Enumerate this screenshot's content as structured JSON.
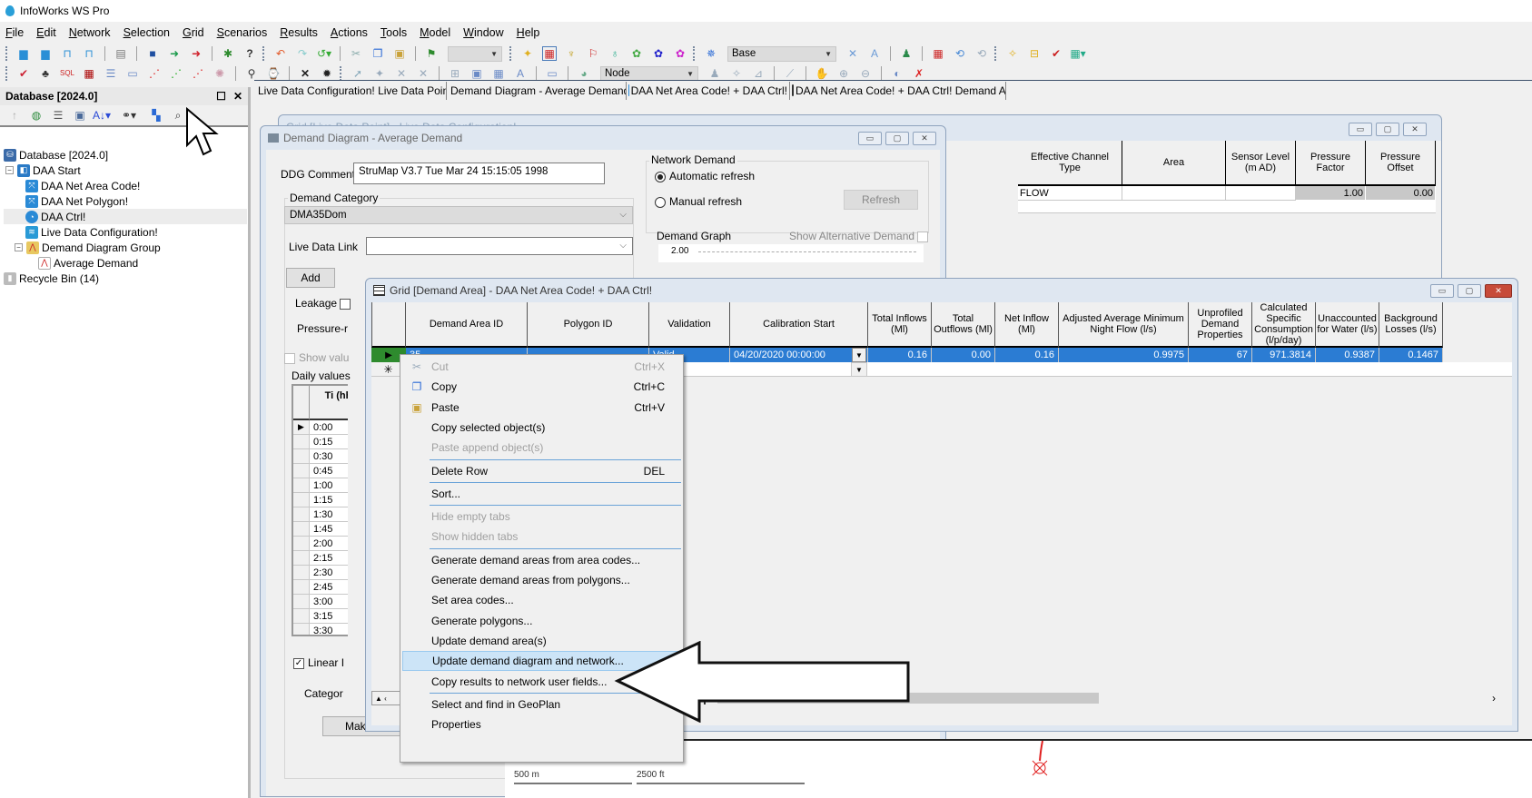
{
  "app": {
    "title": "InfoWorks WS Pro"
  },
  "menu": [
    "File",
    "Edit",
    "Network",
    "Selection",
    "Grid",
    "Scenarios",
    "Results",
    "Actions",
    "Tools",
    "Model",
    "Window",
    "Help"
  ],
  "toolbar": {
    "scenario_combo": "Base",
    "object_combo": "Node",
    "blank_combo": ""
  },
  "database_panel": {
    "title": "Database [2024.0]",
    "tree": [
      {
        "label": "Database [2024.0]",
        "icon": "database-icon",
        "level": 0
      },
      {
        "label": "DAA Start",
        "icon": "model-group-icon",
        "level": 1,
        "expanded": true
      },
      {
        "label": "DAA Net Area Code!",
        "icon": "network-icon",
        "level": 2
      },
      {
        "label": "DAA Net Polygon!",
        "icon": "network-icon",
        "level": 2
      },
      {
        "label": "DAA Ctrl!",
        "icon": "control-icon",
        "level": 2,
        "selected": true
      },
      {
        "label": "Live Data Configuration!",
        "icon": "live-data-icon",
        "level": 2
      },
      {
        "label": "Demand Diagram Group",
        "icon": "demand-group-icon",
        "level": 2,
        "expanded": true
      },
      {
        "label": "Average Demand",
        "icon": "demand-diagram-icon",
        "level": 3
      },
      {
        "label": "Recycle Bin (14)",
        "icon": "recycle-bin-icon",
        "level": 0
      }
    ]
  },
  "doc_tabs": [
    "Live Data Configuration! Live Data Point",
    "Demand Diagram - Average Demand",
    "DAA Net Area Code! + DAA Ctrl!",
    "DAA Net Area Code! + DAA Ctrl! Demand Area"
  ],
  "live_data_grid": {
    "title": "Grid [Live Data Point] - Live Data Configuration!",
    "columns": [
      "Effective Channel Type",
      "Area",
      "Sensor Level (m AD)",
      "Pressure Factor",
      "Pressure Offset"
    ],
    "rows": [
      [
        "FLOW",
        "",
        "",
        "1.00",
        "0.00"
      ]
    ]
  },
  "demand_diagram": {
    "title": "Demand Diagram - Average Demand",
    "ddg_comment_label": "DDG Comment",
    "ddg_comment": "StruMap V3.7 Tue Mar 24 15:15:05 1998",
    "demand_category_label": "Demand Category",
    "demand_category": "DMA35Dom",
    "live_data_link_label": "Live Data Link",
    "live_data_link": "",
    "add_button": "Add",
    "leakage_label": "Leakage",
    "pressure_label": "Pressure-r",
    "show_values_label": "Show valu",
    "daily_values_label": "Daily values",
    "time_header": "Ti (hh:",
    "times": [
      "0:00",
      "0:15",
      "0:30",
      "0:45",
      "1:00",
      "1:15",
      "1:30",
      "1:45",
      "2:00",
      "2:15",
      "2:30",
      "2:45",
      "3:00",
      "3:15",
      "3:30"
    ],
    "linear_label": "Linear I",
    "category_label": "Categor",
    "make_button": "Make",
    "network_demand_label": "Network Demand",
    "automatic_refresh": "Automatic refresh",
    "manual_refresh": "Manual refresh",
    "refresh_mode": "automatic",
    "refresh_button": "Refresh",
    "demand_graph_label": "Demand Graph",
    "show_alt_demand": "Show Alternative Demand",
    "graph_ytick": "2.00"
  },
  "demand_area_grid": {
    "title": "Grid [Demand Area] - DAA Net Area Code! + DAA Ctrl!",
    "columns": [
      "Demand Area ID",
      "Polygon ID",
      "Validation",
      "Calibration Start",
      "Total Inflows (Ml)",
      "Total Outflows (Ml)",
      "Net Inflow (Ml)",
      "Adjusted Average Minimum Night Flow (l/s)",
      "Unprofiled Demand Properties",
      "Calculated Specific Consumption (l/p/day)",
      "Unaccounted for Water (l/s)",
      "Background Losses (l/s)"
    ],
    "rows": [
      [
        "35",
        "",
        "Valid",
        "04/20/2020 00:00:00",
        "0.16",
        "0.00",
        "0.16",
        "0.9975",
        "67",
        "971.3814",
        "0.9387",
        "0.1467"
      ]
    ]
  },
  "context_menu": {
    "items": [
      {
        "label": "Cut",
        "shortcut": "Ctrl+X",
        "disabled": true,
        "icon": "cut-icon"
      },
      {
        "label": "Copy",
        "shortcut": "Ctrl+C",
        "icon": "copy-icon"
      },
      {
        "label": "Paste",
        "shortcut": "Ctrl+V",
        "icon": "paste-icon"
      },
      {
        "label": "Copy selected object(s)"
      },
      {
        "label": "Paste append object(s)",
        "disabled": true
      },
      {
        "separator": true
      },
      {
        "label": "Delete Row",
        "shortcut": "DEL"
      },
      {
        "separator": true
      },
      {
        "label": "Sort..."
      },
      {
        "separator": true
      },
      {
        "label": "Hide empty tabs",
        "disabled": true
      },
      {
        "label": "Show hidden tabs",
        "disabled": true
      },
      {
        "separator": true
      },
      {
        "label": "Generate demand areas from area codes..."
      },
      {
        "label": "Generate demand areas from polygons..."
      },
      {
        "label": "Set area codes..."
      },
      {
        "label": "Generate polygons..."
      },
      {
        "label": "Update demand area(s)"
      },
      {
        "label": "Update demand diagram and network...",
        "highlighted": true
      },
      {
        "label": "Copy results to network user fields..."
      },
      {
        "separator": true
      },
      {
        "label": "Select and find in GeoPlan"
      },
      {
        "label": "Properties"
      }
    ]
  },
  "map": {
    "scale_metric": "500 m",
    "scale_imperial": "2500 ft"
  },
  "colors": {
    "selection": "#2b7cd3",
    "menu_highlight": "#cce4f7",
    "row_indicator": "#2e8b2e",
    "close_red": "#c74b3a"
  }
}
